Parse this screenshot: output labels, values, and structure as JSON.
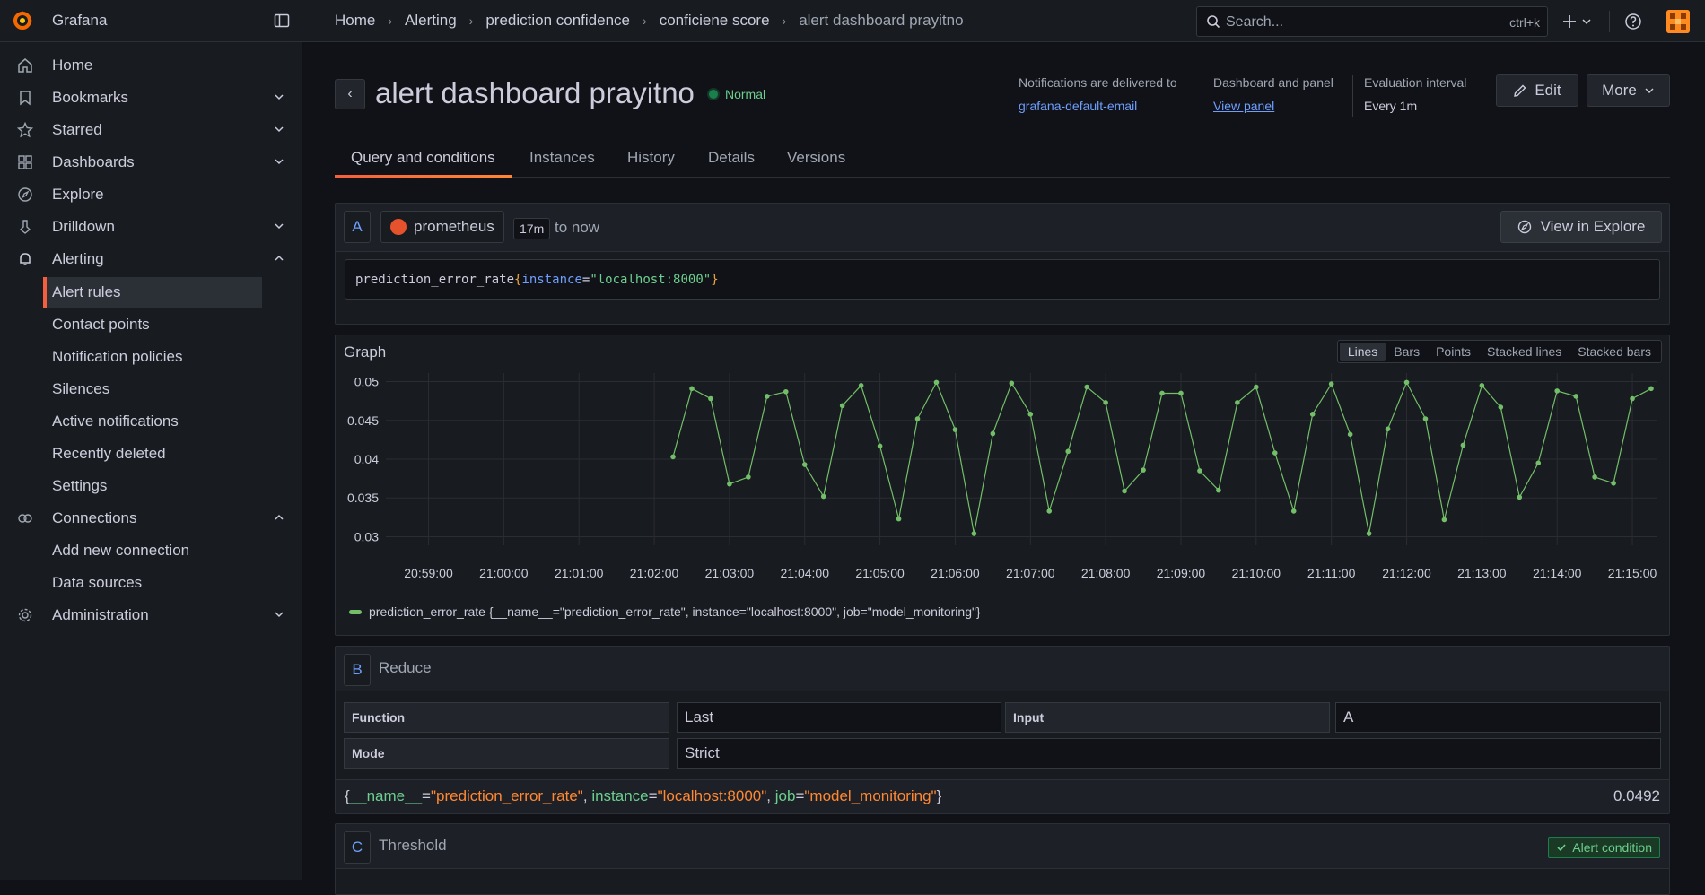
{
  "app": {
    "brand": "Grafana"
  },
  "breadcrumb": [
    "Home",
    "Alerting",
    "prediction confidence",
    "conficiene score",
    "alert dashboard prayitno"
  ],
  "search": {
    "placeholder": "Search...",
    "shortcut": "ctrl+k"
  },
  "sidebar": {
    "items": [
      {
        "label": "Home",
        "icon": "home-icon"
      },
      {
        "label": "Bookmarks",
        "icon": "bookmark-icon"
      },
      {
        "label": "Starred",
        "icon": "star-icon"
      },
      {
        "label": "Dashboards",
        "icon": "dashboards-icon"
      },
      {
        "label": "Explore",
        "icon": "compass-icon"
      },
      {
        "label": "Drilldown",
        "icon": "drilldown-icon"
      },
      {
        "label": "Alerting",
        "icon": "bell-icon"
      },
      {
        "label": "Connections",
        "icon": "connections-icon"
      },
      {
        "label": "Administration",
        "icon": "gear-icon"
      }
    ],
    "alerting_sub": [
      "Alert rules",
      "Contact points",
      "Notification policies",
      "Silences",
      "Active notifications",
      "Recently deleted",
      "Settings"
    ],
    "connections_sub": [
      "Add new connection",
      "Data sources"
    ]
  },
  "rule": {
    "title": "alert dashboard prayitno",
    "state": "Normal",
    "notif_label": "Notifications are delivered to",
    "notif_value": "grafana-default-email",
    "dash_label": "Dashboard and panel",
    "dash_value": "View panel",
    "eval_label": "Evaluation interval",
    "eval_value": "Every 1m",
    "edit": "Edit",
    "more": "More"
  },
  "tabs": [
    "Query and conditions",
    "Instances",
    "History",
    "Details",
    "Versions"
  ],
  "query": {
    "ref": "A",
    "datasource": "prometheus",
    "range": "17m",
    "to": "to now",
    "view_in_explore": "View in Explore",
    "expr_metric": "prediction_error_rate",
    "expr_open": "{",
    "expr_label": "instance",
    "expr_eq": "=",
    "expr_value": "\"localhost:8000\"",
    "expr_close": "}"
  },
  "graph": {
    "title": "Graph",
    "modes": [
      "Lines",
      "Bars",
      "Points",
      "Stacked lines",
      "Stacked bars"
    ],
    "legend": "prediction_error_rate {__name__=\"prediction_error_rate\", instance=\"localhost:8000\", job=\"model_monitoring\"}",
    "color": "#73bf69"
  },
  "chart_data": {
    "type": "line",
    "x_ticks": [
      "20:59:00",
      "21:00:00",
      "21:01:00",
      "21:02:00",
      "21:03:00",
      "21:04:00",
      "21:05:00",
      "21:06:00",
      "21:07:00",
      "21:08:00",
      "21:09:00",
      "21:10:00",
      "21:11:00",
      "21:12:00",
      "21:13:00",
      "21:14:00",
      "21:15:00"
    ],
    "y_ticks": [
      "0.05",
      "0.045",
      "0.04",
      "0.035",
      "0.03"
    ],
    "ylim": [
      0.0289,
      0.0511
    ],
    "xlim": [
      "20:58:26",
      "21:15:20"
    ],
    "series": [
      {
        "name": "prediction_error_rate",
        "x": [
          "21:02:15",
          "21:02:30",
          "21:02:45",
          "21:03:00",
          "21:03:15",
          "21:03:30",
          "21:03:45",
          "21:04:00",
          "21:04:15",
          "21:04:30",
          "21:04:45",
          "21:05:00",
          "21:05:15",
          "21:05:30",
          "21:05:45",
          "21:06:00",
          "21:06:15",
          "21:06:30",
          "21:06:45",
          "21:07:00",
          "21:07:15",
          "21:07:30",
          "21:07:45",
          "21:08:00",
          "21:08:15",
          "21:08:30",
          "21:08:45",
          "21:09:00",
          "21:09:15",
          "21:09:30",
          "21:09:45",
          "21:10:00",
          "21:10:15",
          "21:10:30",
          "21:10:45",
          "21:11:00",
          "21:11:15",
          "21:11:30",
          "21:11:45",
          "21:12:00",
          "21:12:15",
          "21:12:30",
          "21:12:45",
          "21:13:00",
          "21:13:15",
          "21:13:30",
          "21:13:45",
          "21:14:00",
          "21:14:15",
          "21:14:30",
          "21:14:45",
          "21:15:00",
          "21:15:15"
        ],
        "values": [
          0.0403,
          0.0491,
          0.0478,
          0.0368,
          0.0377,
          0.0481,
          0.0487,
          0.0393,
          0.0352,
          0.0469,
          0.0495,
          0.0417,
          0.0323,
          0.0452,
          0.0499,
          0.0438,
          0.0304,
          0.0433,
          0.0498,
          0.0458,
          0.0333,
          0.041,
          0.0493,
          0.0473,
          0.0359,
          0.0386,
          0.0485,
          0.0485,
          0.0385,
          0.036,
          0.0473,
          0.0493,
          0.0408,
          0.0333,
          0.0458,
          0.0497,
          0.0432,
          0.0304,
          0.0439,
          0.0499,
          0.0452,
          0.0322,
          0.0418,
          0.0495,
          0.0467,
          0.0351,
          0.0395,
          0.0488,
          0.0481,
          0.0377,
          0.0369,
          0.0478,
          0.0491
        ]
      }
    ]
  },
  "reduce": {
    "ref": "B",
    "title": "Reduce",
    "function_label": "Function",
    "function_value": "Last",
    "input_label": "Input",
    "input_value": "A",
    "mode_label": "Mode",
    "mode_value": "Strict",
    "res_open": "{",
    "res_k1": "__name__",
    "res_v1": "\"prediction_error_rate\"",
    "res_k2": "instance",
    "res_v2": "\"localhost:8000\"",
    "res_k3": "job",
    "res_v3": "\"model_monitoring\"",
    "res_close": "}",
    "result": "0.0492"
  },
  "threshold": {
    "ref": "C",
    "title": "Threshold",
    "badge": "Alert condition"
  }
}
